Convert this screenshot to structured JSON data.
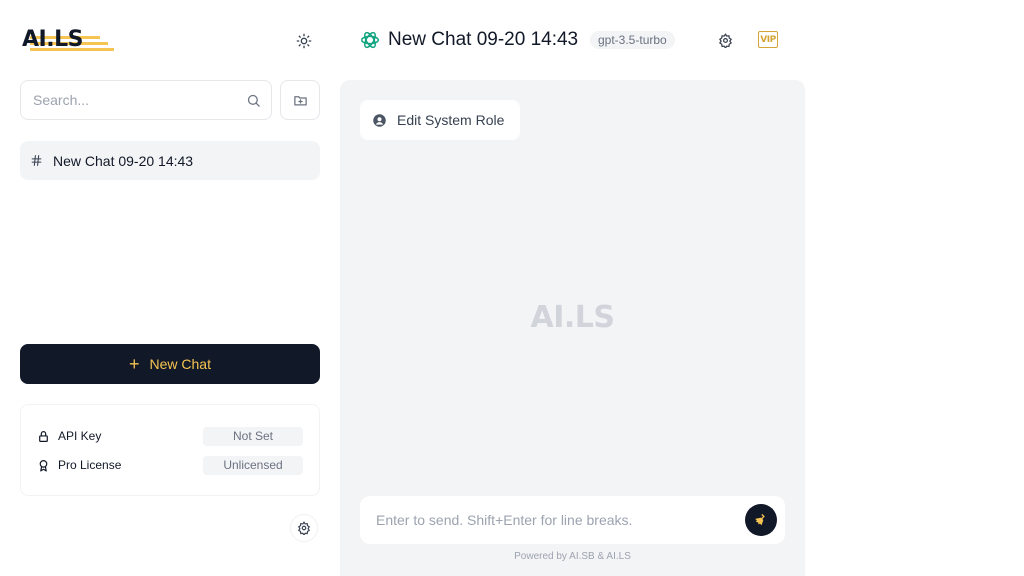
{
  "brand": {
    "logo_text": "AI.LS",
    "accent_color": "#f6c453",
    "dark_color": "#111827"
  },
  "sidebar": {
    "search": {
      "placeholder": "Search...",
      "value": ""
    },
    "chats": [
      {
        "label": "New Chat 09-20 14:43",
        "icon": "hash-icon"
      }
    ],
    "new_chat_label": "New Chat",
    "settings": [
      {
        "name": "API Key",
        "icon": "lock-icon",
        "value": "Not Set"
      },
      {
        "name": "Pro License",
        "icon": "award-icon",
        "value": "Unlicensed"
      }
    ]
  },
  "header": {
    "title": "New Chat 09-20 14:43",
    "model": "gpt-3.5-turbo",
    "vip_label": "VIP"
  },
  "main": {
    "edit_role_label": "Edit System Role",
    "watermark": "AI.LS",
    "composer_placeholder": "Enter to send. Shift+Enter for line breaks.",
    "footer": "Powered by AI.SB & AI.LS"
  }
}
